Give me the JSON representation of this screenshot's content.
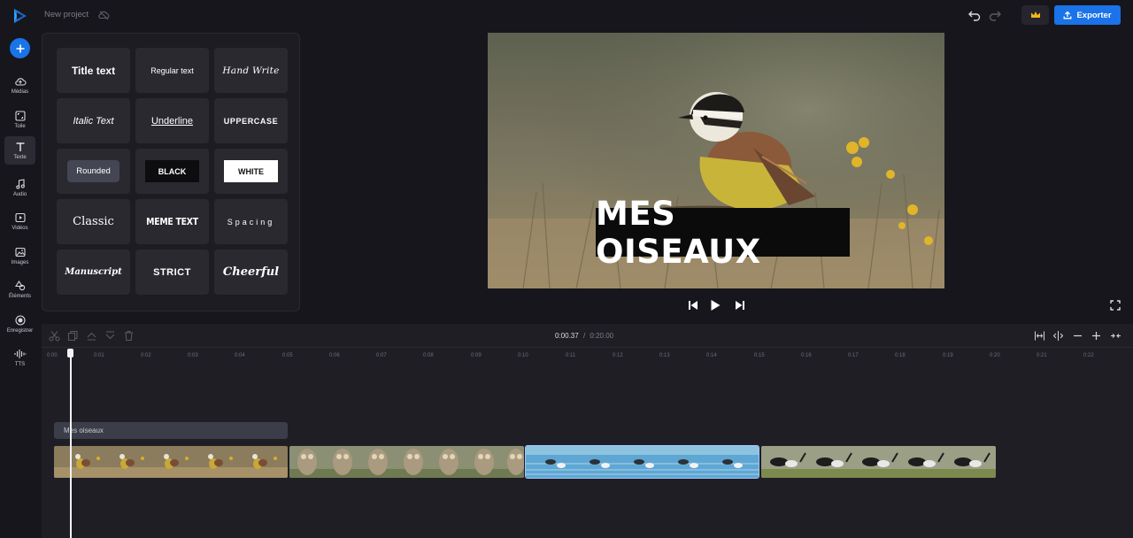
{
  "header": {
    "project_title": "New project",
    "export_label": "Exporter",
    "icons": [
      "app-logo-icon",
      "cloud-icon",
      "undo-icon",
      "redo-icon",
      "crown-icon",
      "upload-icon"
    ]
  },
  "nav": {
    "items": [
      {
        "label": "Médias",
        "icon": "cloud-upload-icon"
      },
      {
        "label": "Toile",
        "icon": "canvas-icon"
      },
      {
        "label": "Texte",
        "icon": "text-icon",
        "active": true
      },
      {
        "label": "Audio",
        "icon": "music-note-icon"
      },
      {
        "label": "Vidéos",
        "icon": "video-icon"
      },
      {
        "label": "Images",
        "icon": "image-icon"
      },
      {
        "label": "Éléments",
        "icon": "shapes-icon"
      },
      {
        "label": "Enregistrer",
        "icon": "record-icon"
      },
      {
        "label": "TTS",
        "icon": "waveform-icon"
      }
    ]
  },
  "text_styles": [
    {
      "label": "Title text"
    },
    {
      "label": "Regular text"
    },
    {
      "label": "Hand Write"
    },
    {
      "label": "Italic Text"
    },
    {
      "label": "Underline"
    },
    {
      "label": "UPPERCASE"
    },
    {
      "label": "Rounded"
    },
    {
      "label": "BLACK"
    },
    {
      "label": "WHITE"
    },
    {
      "label": "Classic"
    },
    {
      "label": "MEME TEXT"
    },
    {
      "label": "Spacing"
    },
    {
      "label": "Manuscript"
    },
    {
      "label": "STRICT"
    },
    {
      "label": "Cheerful"
    }
  ],
  "preview": {
    "caption": "MES OISEAUX"
  },
  "timeline": {
    "current_time": "0:00.37",
    "separator": "/",
    "total_time": "0:20.00",
    "ruler": [
      "0:00",
      "0:01",
      "0:02",
      "0:03",
      "0:04",
      "0:05",
      "0:06",
      "0:07",
      "0:08",
      "0:09",
      "0:10",
      "0:11",
      "0:12",
      "0:13",
      "0:14",
      "0:15",
      "0:16",
      "0:17",
      "0:18",
      "0:19",
      "0:20",
      "0:21",
      "0:22"
    ],
    "text_clip_label": "Mes oiseaux",
    "clips": [
      {
        "subject": "kiskadee bird"
      },
      {
        "subject": "owls"
      },
      {
        "subject": "birds on water"
      },
      {
        "subject": "canada geese"
      }
    ]
  },
  "colors": {
    "accent": "#1a73e8",
    "background": "#17161d",
    "panel": "#1d1c23",
    "tile": "#2a2930",
    "crown": "#f5b51c"
  }
}
